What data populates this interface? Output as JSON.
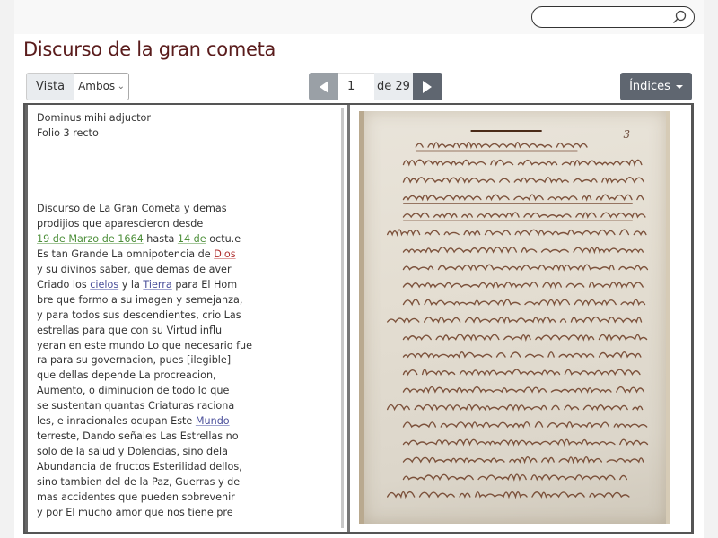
{
  "search": {
    "placeholder": "",
    "value": "",
    "icon": "search-icon"
  },
  "page": {
    "title": "Discurso de la gran cometa"
  },
  "toolbar": {
    "vista_label": "Vista",
    "vista_selected": "Ambos",
    "pager": {
      "current_page": "1",
      "total_label": "de 29",
      "prev_icon": "triangle-left-icon",
      "next_icon": "triangle-right-icon"
    },
    "indices_label": "Índices"
  },
  "transcription": {
    "header_lines": [
      "Dominus mihi adjuctor",
      "Folio 3 recto"
    ],
    "lines": [
      [
        {
          "t": "Discurso de La Gran Cometa y demas"
        }
      ],
      [
        {
          "t": "prodijios que aparescieron desde"
        }
      ],
      [
        {
          "t": "19 de Marzo de 1664",
          "link": "date"
        },
        {
          "t": " hasta "
        },
        {
          "t": "14 de",
          "link": "date"
        },
        {
          "t": " octu.e"
        }
      ],
      [
        {
          "t": "Es tan Grande La omnipotencia de "
        },
        {
          "t": "Dios",
          "link": "red"
        }
      ],
      [
        {
          "t": "y su divinos saber, que demas de aver"
        }
      ],
      [
        {
          "t": "Criado los "
        },
        {
          "t": "cielos",
          "link": "blue"
        },
        {
          "t": " y la "
        },
        {
          "t": "Tierra",
          "link": "blue"
        },
        {
          "t": " para El Hom"
        }
      ],
      [
        {
          "t": "bre que formo a su imagen y semejanza,"
        }
      ],
      [
        {
          "t": "y para todos sus descendientes, crio Las"
        }
      ],
      [
        {
          "t": "estrellas para que con su Virtud influ"
        }
      ],
      [
        {
          "t": "yeran en este mundo Lo que necesario fue"
        }
      ],
      [
        {
          "t": "ra para su governacion, pues [ilegible]"
        }
      ],
      [
        {
          "t": "que dellas depende La procreacion,"
        }
      ],
      [
        {
          "t": "Aumento, o diminucion de todo lo que"
        }
      ],
      [
        {
          "t": "se sustentan quantas Criaturas raciona"
        }
      ],
      [
        {
          "t": "les, e inracionales ocupan Este "
        },
        {
          "t": "Mundo",
          "link": "blue"
        }
      ],
      [
        {
          "t": "terreste, Dando señales Las Estrellas no"
        }
      ],
      [
        {
          "t": "solo de la salud y Dolencias, sino dela"
        }
      ],
      [
        {
          "t": "Abundancia de fructos Esterilidad dellos,"
        }
      ],
      [
        {
          "t": "sino tambien del de la Paz, Guerras y de"
        }
      ],
      [
        {
          "t": "mas accidentes que pueden sobrevenir"
        }
      ],
      [
        {
          "t": "y por El mucho amor que nos tiene pre"
        }
      ]
    ]
  },
  "manuscript": {
    "alt": "Manuscript facsimile, folio 3 recto",
    "folio_number": "3",
    "heading": "=Dominus mihi Adiuctor="
  },
  "colors": {
    "title": "#5a1c1c",
    "date_link": "#4d8f3a",
    "person_link": "#b03030",
    "place_link": "#4a4f9a",
    "button_dark": "#5f6670",
    "button_light": "#9aa0a6"
  }
}
